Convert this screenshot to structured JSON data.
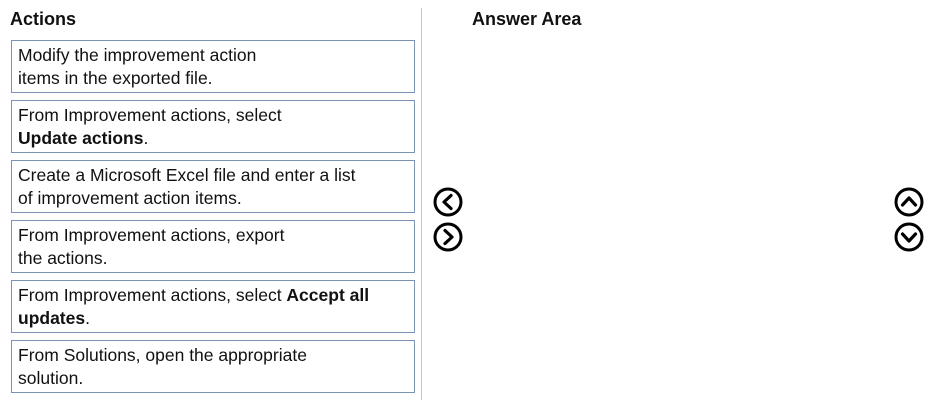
{
  "headers": {
    "actions": "Actions",
    "answer_area": "Answer Area"
  },
  "actions": [
    {
      "text": "Modify the improvement action items in the exported file.",
      "line1": "Modify the improvement action",
      "line2": "items in the exported file."
    },
    {
      "line1": "From Improvement actions, select",
      "bold2": "Update actions",
      "tail2": "."
    },
    {
      "line1": "Create a Microsoft Excel file and enter a list",
      "line2": "of improvement action items."
    },
    {
      "line1": "From Improvement actions, export",
      "line2": "the actions."
    },
    {
      "line1a": "From Improvement actions, select ",
      "bold1": "Accept all",
      "bold2": "updates",
      "tail2": "."
    },
    {
      "line1": "From Solutions, open the appropriate",
      "line2": "solution."
    }
  ],
  "icons": {
    "move_left": "chevron-left-circle-icon",
    "move_right": "chevron-right-circle-icon",
    "move_up": "chevron-up-circle-icon",
    "move_down": "chevron-down-circle-icon"
  }
}
